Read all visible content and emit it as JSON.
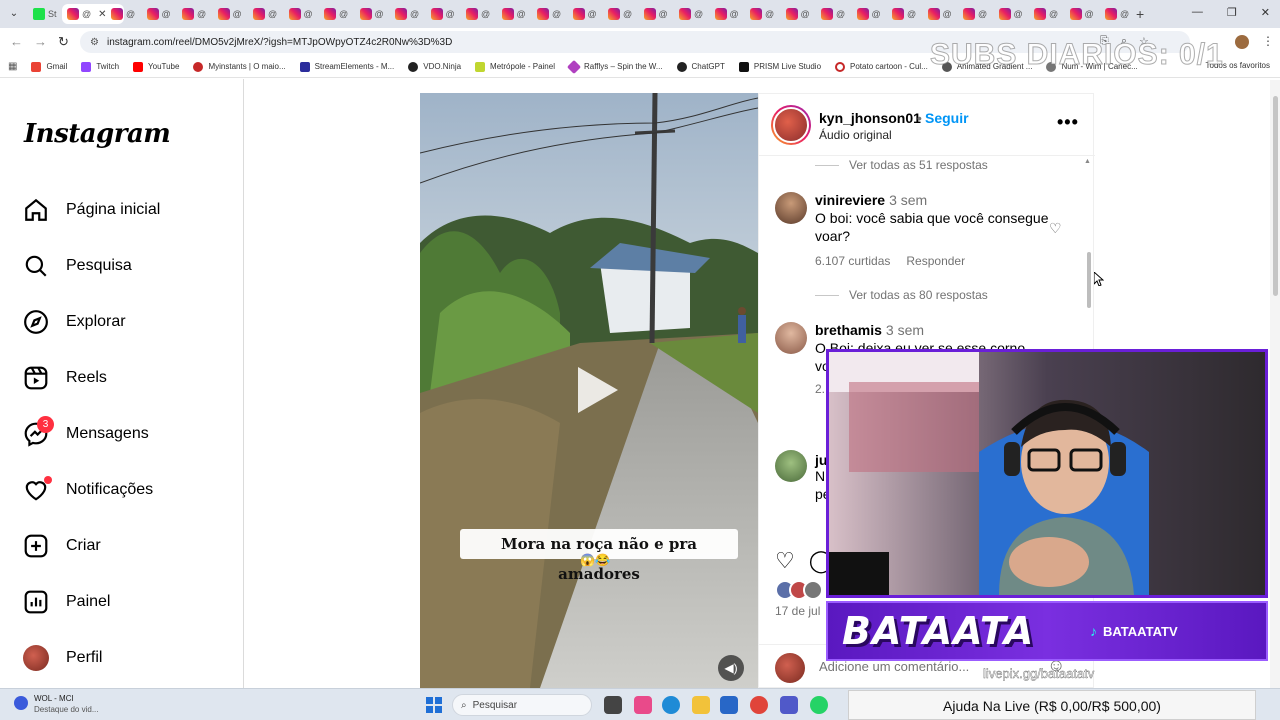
{
  "browser": {
    "active_tab_label": "St",
    "tab_label_short": "@",
    "url": "instagram.com/reel/DMO5v2jMreX/?igsh=MTJpOWpyOTZ4c2R0Nw%3D%3D",
    "bookmarks": [
      "Gmail",
      "Twitch",
      "YouTube",
      "Myinstants | O maio...",
      "StreamElements - M...",
      "VDO.Ninja",
      "Metrópole - Painel",
      "Rafflys – Spin the W...",
      "ChatGPT",
      "PRISM Live Studio",
      "Potato cartoon - Cul...",
      "Animated Gradient ...",
      "Num - Wim | Canec..."
    ],
    "bookmarks_all": "Todos os favoritos"
  },
  "stream_overlay": {
    "subs_counter": "SUBS DIARIOS: 0/1",
    "brand_name": "BATAATA",
    "social_handle": "BATAATATV",
    "livepix_url": "livepix.gg/bataatatv",
    "donation_goal": "Ajuda Na Live (R$ 0,00/R$ 500,00)"
  },
  "instagram": {
    "logo": "Instagram",
    "nav": [
      {
        "label": "Página inicial",
        "icon": "home-icon"
      },
      {
        "label": "Pesquisa",
        "icon": "search-icon"
      },
      {
        "label": "Explorar",
        "icon": "compass-icon"
      },
      {
        "label": "Reels",
        "icon": "reels-icon"
      },
      {
        "label": "Mensagens",
        "icon": "messenger-icon",
        "badge": "3"
      },
      {
        "label": "Notificações",
        "icon": "heart-icon"
      },
      {
        "label": "Criar",
        "icon": "plus-square-icon"
      },
      {
        "label": "Painel",
        "icon": "chart-icon"
      },
      {
        "label": "Perfil",
        "icon": "avatar"
      }
    ],
    "reel": {
      "caption": "Mora na roça não e pra amadores",
      "caption_emoji": "😱😂"
    },
    "post": {
      "username": "kyn_jhonson01",
      "dot": "•",
      "follow": "Seguir",
      "audio": "Áudio original",
      "date": "17 de jul"
    },
    "comments": [
      {
        "view_replies": "Ver todas as 51 respostas"
      },
      {
        "user": "vinireviere",
        "time": "3 sem",
        "text": "O boi: você sabia que você consegue voar?",
        "likes": "6.107 curtidas",
        "reply": "Responder",
        "view_replies": "Ver todas as 80 respostas"
      },
      {
        "user": "brethamis",
        "time": "3 sem",
        "text": "O Boi: deixa eu ver se esse corno voa"
      },
      {
        "user": "ju",
        "text": "N pe"
      }
    ],
    "comment_count_partial": "2.",
    "add_comment_placeholder": "Adicione um comentário..."
  },
  "taskbar": {
    "weather_title": "WOL - MCI",
    "weather_sub": "Destaque do vid...",
    "search_label": "Pesquisar"
  }
}
